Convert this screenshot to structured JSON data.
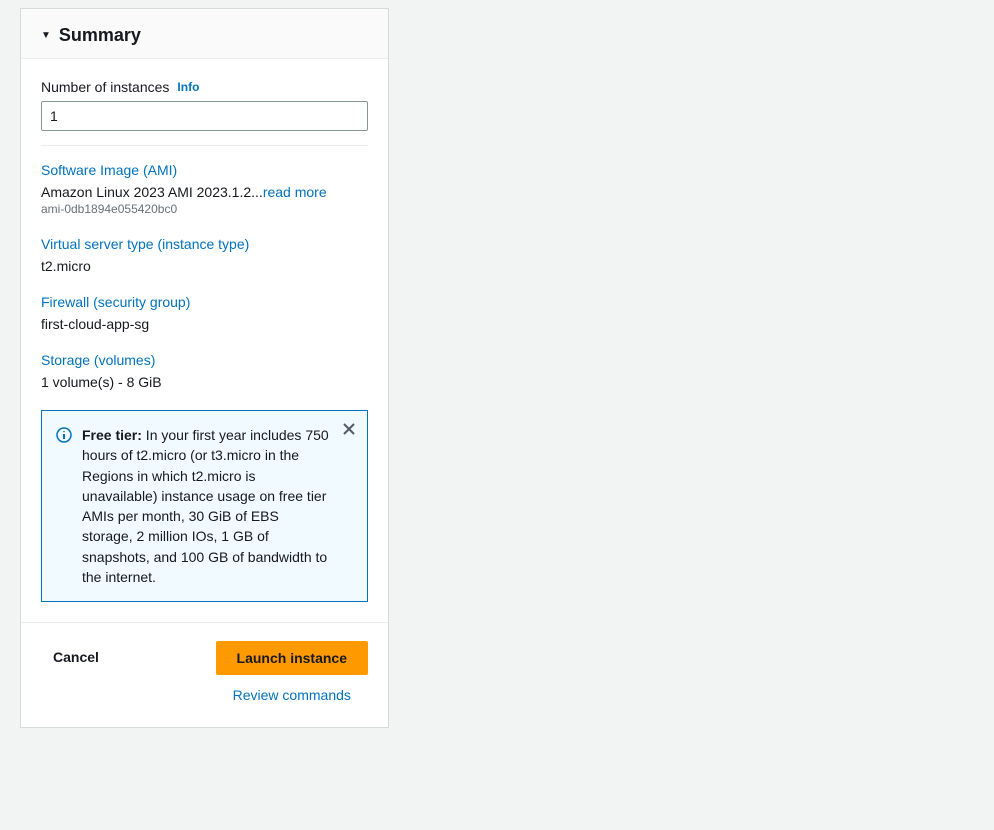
{
  "header": {
    "title": "Summary"
  },
  "instances": {
    "label": "Number of instances",
    "info": "Info",
    "value": "1"
  },
  "ami": {
    "title": "Software Image (AMI)",
    "value": "Amazon Linux 2023 AMI 2023.1.2...",
    "read_more": "read more",
    "id": "ami-0db1894e055420bc0"
  },
  "instance_type": {
    "title": "Virtual server type (instance type)",
    "value": "t2.micro"
  },
  "firewall": {
    "title": "Firewall (security group)",
    "value": "first-cloud-app-sg"
  },
  "storage": {
    "title": "Storage (volumes)",
    "value": "1 volume(s) - 8 GiB"
  },
  "free_tier": {
    "label": "Free tier:",
    "text": " In your first year includes 750 hours of t2.micro (or t3.micro in the Regions in which t2.micro is unavailable) instance usage on free tier AMIs per month, 30 GiB of EBS storage, 2 million IOs, 1 GB of snapshots, and 100 GB of bandwidth to the internet."
  },
  "footer": {
    "cancel": "Cancel",
    "launch": "Launch instance",
    "review": "Review commands"
  }
}
